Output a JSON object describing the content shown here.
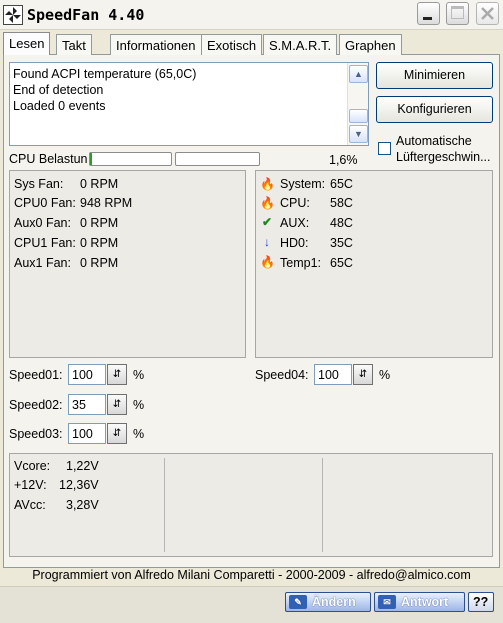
{
  "window": {
    "title": "SpeedFan 4.40"
  },
  "tabs": [
    "Lesen",
    "Takt",
    "Informationen",
    "Exotisch",
    "S.M.A.R.T.",
    "Graphen"
  ],
  "log": [
    "Found ACPI temperature (65,0C)",
    "End of detection",
    "Loaded 0 events"
  ],
  "buttons": {
    "minimize": "Minimieren",
    "configure": "Konfigurieren"
  },
  "auto_fan": {
    "label_line1": "Automatische",
    "label_line2": "Lüftergeschwin...",
    "checked": false
  },
  "cpu_load": {
    "label": "CPU Belastun",
    "value_text": "1,6%"
  },
  "fans": [
    {
      "label": "Sys Fan:",
      "value": "0 RPM"
    },
    {
      "label": "CPU0 Fan:",
      "value": "948 RPM"
    },
    {
      "label": "Aux0 Fan:",
      "value": "0 RPM"
    },
    {
      "label": "CPU1 Fan:",
      "value": "0 RPM"
    },
    {
      "label": "Aux1 Fan:",
      "value": "0 RPM"
    }
  ],
  "temps": [
    {
      "icon": "flame-icon",
      "label": "System:",
      "value": "65C"
    },
    {
      "icon": "flame-icon",
      "label": "CPU:",
      "value": "58C"
    },
    {
      "icon": "checkmark-icon",
      "label": "AUX:",
      "value": "48C"
    },
    {
      "icon": "arrow-down-icon",
      "label": "HD0:",
      "value": "35C"
    },
    {
      "icon": "flame-icon",
      "label": "Temp1:",
      "value": "65C"
    }
  ],
  "speeds": [
    {
      "label": "Speed01:",
      "value": "100",
      "unit": "%"
    },
    {
      "label": "Speed02:",
      "value": "35",
      "unit": "%"
    },
    {
      "label": "Speed03:",
      "value": "100",
      "unit": "%"
    },
    {
      "label": "Speed04:",
      "value": "100",
      "unit": "%"
    }
  ],
  "voltages": [
    {
      "label": "Vcore:",
      "value": "1,22V"
    },
    {
      "label": "+12V:",
      "value": "12,36V"
    },
    {
      "label": "AVcc:",
      "value": "3,28V"
    }
  ],
  "footer": "Programmiert von Alfredo Milani Comparetti - 2000-2009 - alfredo@almico.com",
  "taskbar": {
    "change": "Ändern",
    "reply": "Antwort",
    "help": "??"
  },
  "colors": {
    "flame": "#e8430a",
    "check": "#1e8a1e",
    "arrow": "#1f3fd6"
  }
}
